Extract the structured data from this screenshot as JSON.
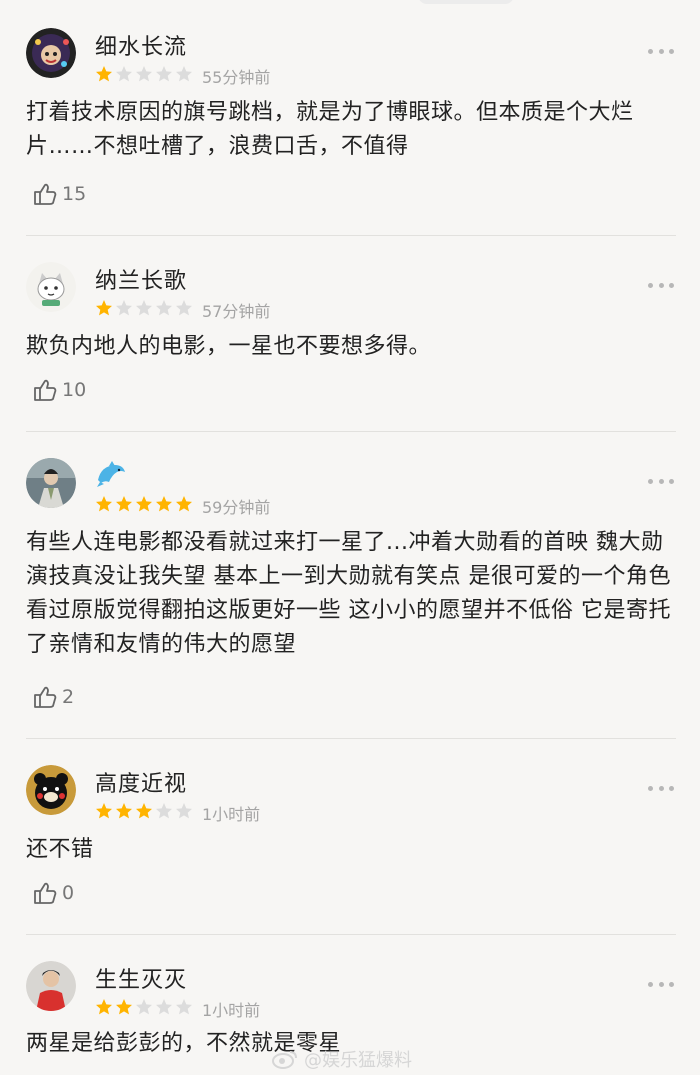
{
  "reviews": [
    {
      "user": "细水长流",
      "rating": 1,
      "time": "55分钟前",
      "content": "打着技术原因的旗号跳档，就是为了博眼球。但本质是个大烂片……不想吐槽了，浪费口舌，不值得",
      "likes": "15",
      "avatar_icon": "afro-cartoon-avatar"
    },
    {
      "user": "纳兰长歌",
      "rating": 1,
      "time": "57分钟前",
      "content": "欺负内地人的电影，一星也不要想多得。",
      "likes": "10",
      "avatar_icon": "cartoon-cat-avatar"
    },
    {
      "user": "",
      "rating": 5,
      "time": "59分钟前",
      "content": "有些人连电影都没看就过来打一星了...冲着大勋看的首映 魏大勋演技真没让我失望 基本上一到大勋就有笑点 是很可爱的一个角色 看过原版觉得翻拍这版更好一些 这小小的愿望并不低俗 它是寄托了亲情和友情的伟大的愿望",
      "likes": "2",
      "avatar_icon": "costume-drama-avatar",
      "name_icon": "dolphin-emoji-icon"
    },
    {
      "user": "高度近视",
      "rating": 3,
      "time": "1小时前",
      "content": "还不错",
      "likes": "0",
      "avatar_icon": "black-bear-avatar"
    },
    {
      "user": "生生灭灭",
      "rating": 2,
      "time": "1小时前",
      "content": "两星是给彭彭的，不然就是零星",
      "likes": "",
      "avatar_icon": "person-red-shirt-avatar"
    }
  ],
  "watermark": "@娱乐猛爆料",
  "colors": {
    "star_filled": "#ffb400",
    "star_empty": "#dcdcdc",
    "background": "#f7f6f4"
  }
}
